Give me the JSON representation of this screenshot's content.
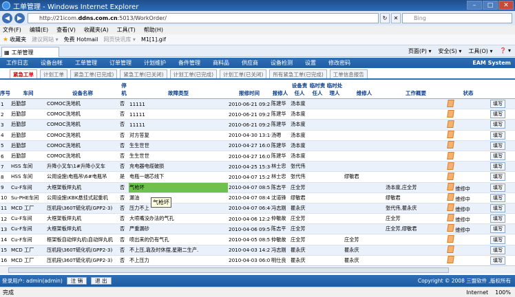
{
  "window": {
    "title": "工单管理 - Windows Internet Explorer",
    "min": "–",
    "max": "□",
    "close": "✕"
  },
  "address": {
    "prefix": "http://21icom.",
    "host": "ddns.com.cn",
    "path": ":5013/WorkOrder/",
    "search_placeholder": "Bing"
  },
  "menu": [
    "文件(F)",
    "编辑(E)",
    "查看(V)",
    "收藏夹(A)",
    "工具(T)",
    "帮助(H)"
  ],
  "favorites": {
    "label": "收藏夹",
    "items": [
      "建议网站 ▾",
      "免费 Hotmail",
      "网页快讯库 ▾",
      "M1[1].gif"
    ]
  },
  "ie_tab": {
    "label": "工单管理"
  },
  "ie_tools": [
    "页面(P) ▾",
    "安全(S) ▾",
    "工具(O) ▾",
    "❓ ▾"
  ],
  "app_nav": {
    "items": [
      "工作日志",
      "设备台帐",
      "工单管理",
      "订单管理",
      "计划维护",
      "备件管理",
      "商料品",
      "供应商",
      "设备检测",
      "设置",
      "修改密码"
    ],
    "brand": "EAM System"
  },
  "subtabs": [
    "紧急工单",
    "计划工单",
    "紧急工单(已完成)",
    "紧急工单(已关闭)",
    "计划工单(已完成)",
    "计划工单(已关闭)",
    "所有紧急工单(已完成)",
    "工单信息报告"
  ],
  "columns": [
    "序号",
    "车间",
    "设备名称",
    "停机",
    "故障类型",
    "报修时间",
    "报修人",
    "设备责任人",
    "临时责任人",
    "临时处理人",
    "维修人",
    "工作概要",
    "状态",
    ""
  ],
  "rows": [
    [
      "1",
      "后勤部",
      "COMOC洗地机",
      "否",
      "11111",
      "2010-06-21 09:28",
      "陈建华",
      "汤本度",
      "",
      "",
      "",
      "",
      "",
      "填写"
    ],
    [
      "2",
      "后勤部",
      "COMOC洗地机",
      "否",
      "11111",
      "2010-06-21 09:27",
      "陈建华",
      "汤本度",
      "",
      "",
      "",
      "",
      "",
      "填写"
    ],
    [
      "3",
      "后勤部",
      "COMOC洗地机",
      "否",
      "11111",
      "2010-06-21 09:26",
      "陈建华",
      "汤本度",
      "",
      "",
      "",
      "",
      "",
      "填写"
    ],
    [
      "4",
      "后勤部",
      "COMOC洗地机",
      "否",
      "对方答复",
      "2010-04-30 13:10",
      "汤嗯",
      "汤本度",
      "",
      "",
      "",
      "",
      "",
      "填写"
    ],
    [
      "5",
      "后勤部",
      "COMOC洗地机",
      "否",
      "生生世世",
      "2010-04-27 16:03",
      "陈建华",
      "汤本度",
      "",
      "",
      "",
      "",
      "",
      "填写"
    ],
    [
      "6",
      "后勤部",
      "COMOC洗地机",
      "否",
      "生生世世",
      "2010-04-27 16:02",
      "陈建华",
      "汤本度",
      "",
      "",
      "",
      "",
      "",
      "填写"
    ],
    [
      "7",
      "HSS 车间",
      "升降小叉车\\1#升降小叉车",
      "否",
      "充电器电缆破损",
      "2010-04-25 15:30",
      "林士忠",
      "张代伟",
      "",
      "",
      "",
      "",
      "",
      "填写"
    ],
    [
      "8",
      "HSS 车间",
      "公用设施\\电瓶吊\\6#电瓶吊",
      "是",
      "电瓶一端芯线下",
      "2010-04-07 15:27",
      "林士忠",
      "张代伟",
      "",
      "",
      "缪敏君",
      "",
      "",
      "填写"
    ],
    [
      "9",
      "Cu-F车间",
      "大框架板焊丸机",
      "否",
      "气枪坏",
      "2010-04-07 08:53",
      "陈志平",
      "庄全芳",
      "",
      "",
      "",
      "汤本度,庄全芳",
      "维修中",
      "填写"
    ],
    [
      "10",
      "Su-PHE车间",
      "公用设施\\KBK悬挂式起重机",
      "否",
      "漏油",
      "2010-04-07 08:41",
      "沈道锋",
      "缪敏君",
      "",
      "",
      "",
      "缪敏君",
      "维修中",
      "填写"
    ],
    [
      "11",
      "MCD 工厂",
      "压机段\\360T硫化机(GPP2-3)",
      "否",
      "压力不上",
      "2010-04-07 06:40",
      "冯志刚",
      "瞿永庆",
      "",
      "",
      "",
      "张代伟,瞿永庆",
      "维修中",
      "填写"
    ],
    [
      "12",
      "Cu-F车间",
      "大框架板焊丸机",
      "否",
      "大喷嘴没办法的气孔",
      "2010-04-06 12:26",
      "仲敏故",
      "庄全芳",
      "",
      "",
      "",
      "庄全芳",
      "维修中",
      "填写"
    ],
    [
      "13",
      "Cu-F车间",
      "大框架板焊丸机",
      "否",
      "严重漏砂",
      "2010-04-06 09:56",
      "陈志平",
      "庄全芳",
      "",
      "",
      "",
      "庄全芳,缪敏君",
      "维修中",
      "填写"
    ],
    [
      "14",
      "Cu-F车间",
      "框架板自动焊丸机\\自动焊丸机",
      "否",
      "喷出来的仍有气孔",
      "2010-04-05 08:58",
      "仲敏故",
      "庄全芳",
      "",
      "",
      "庄全芳",
      "",
      "",
      "填写"
    ],
    [
      "15",
      "MCD 工厂",
      "压机段\\360T硫化机(GPP2-3)",
      "否",
      "不上压,靠及时休摆,星期二生产.",
      "2010-04-03 14:27",
      "冯志刚",
      "瞿永庆",
      "",
      "",
      "瞿永庆",
      "",
      "",
      "填写"
    ],
    [
      "16",
      "MCD 工厂",
      "压机段\\360T硫化机(GPP2-3)",
      "否",
      "不上压力",
      "2010-04-03 06:07",
      "明仕良",
      "瞿永庆",
      "",
      "",
      "瞿永庆",
      "",
      "",
      "填写"
    ]
  ],
  "tooltip": "气枪坏",
  "footer": {
    "user": "登录用户: admin(admin)",
    "btn1": "注 销",
    "btn2": "退 出",
    "copyright": "Copyright © 2008 三盟软件 ,版权所有"
  },
  "status": {
    "left": "完成",
    "zone": "Internet",
    "zoom": "100%"
  }
}
